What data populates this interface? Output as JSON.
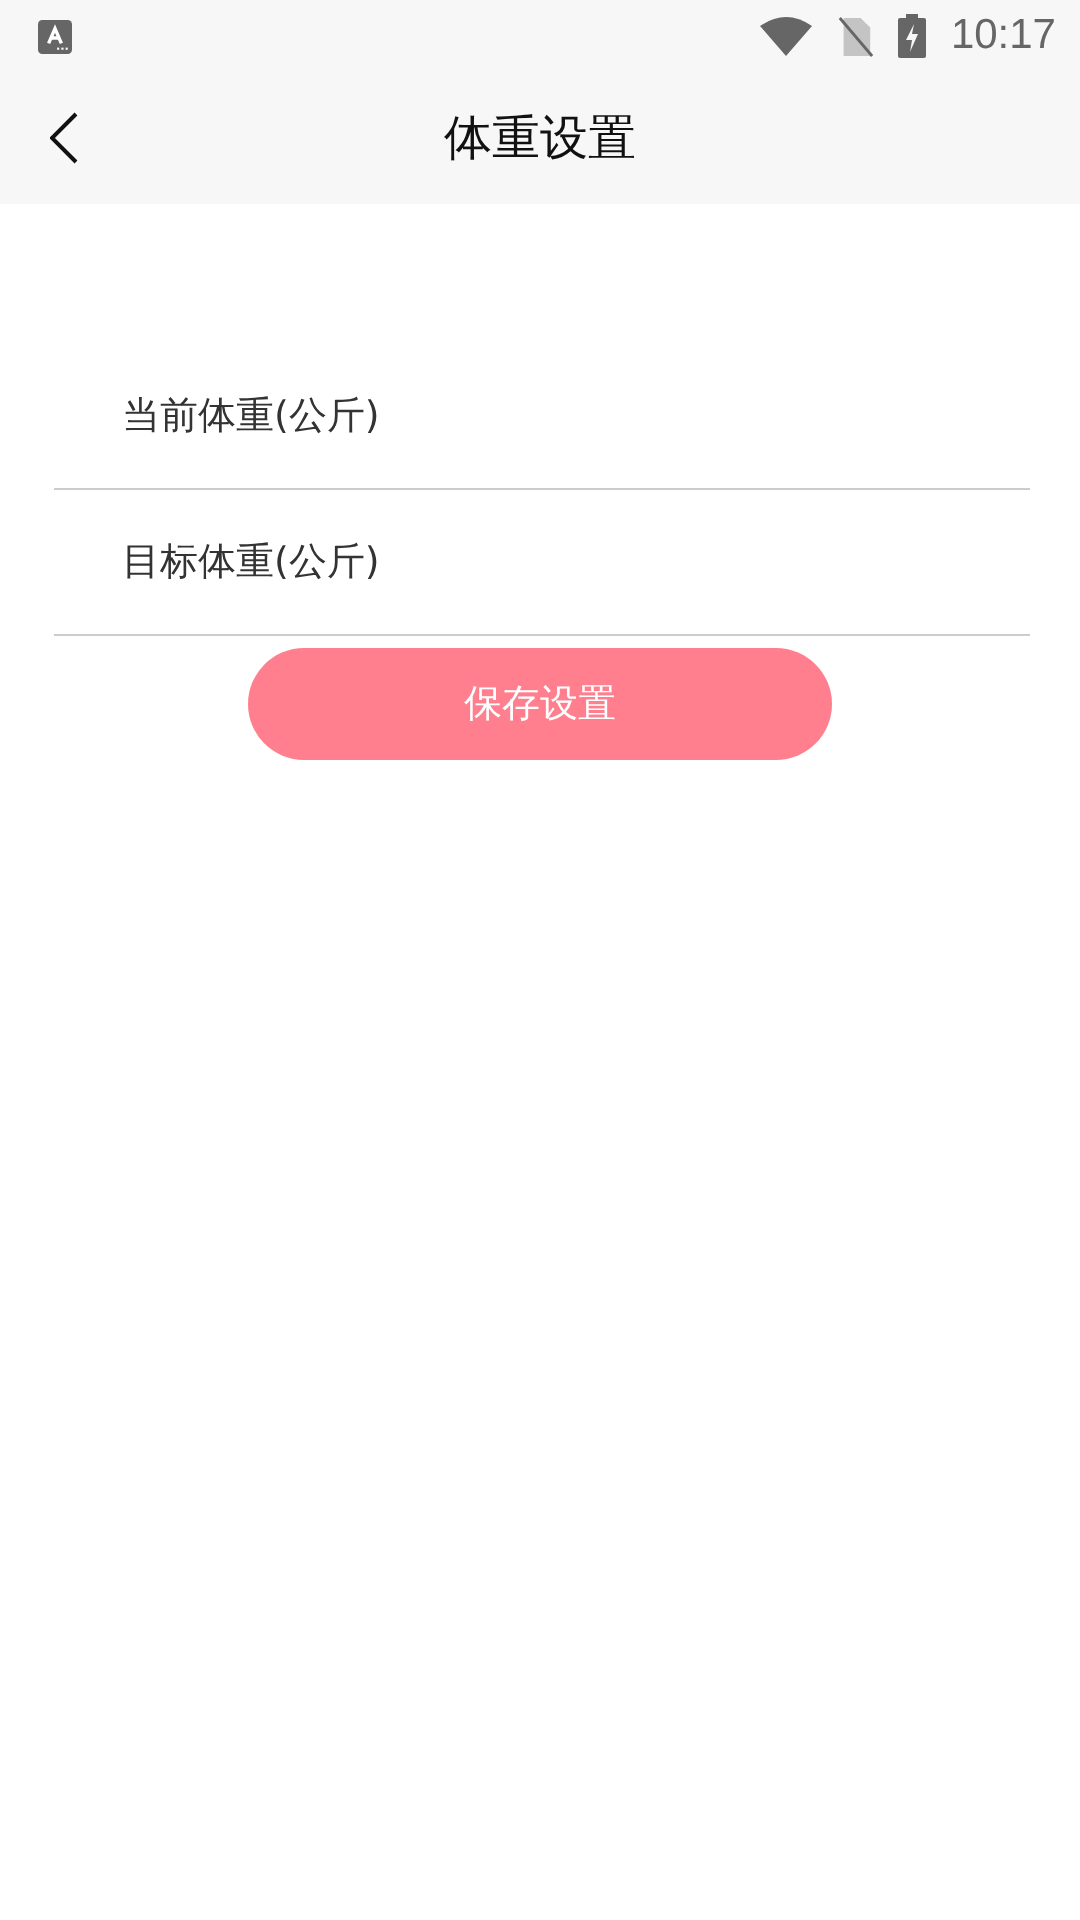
{
  "status_bar": {
    "time": "10:17"
  },
  "toolbar": {
    "title": "体重设置"
  },
  "fields": [
    {
      "placeholder": "当前体重(公斤)"
    },
    {
      "placeholder": "目标体重(公斤)"
    }
  ],
  "save_button": {
    "label": "保存设置"
  }
}
